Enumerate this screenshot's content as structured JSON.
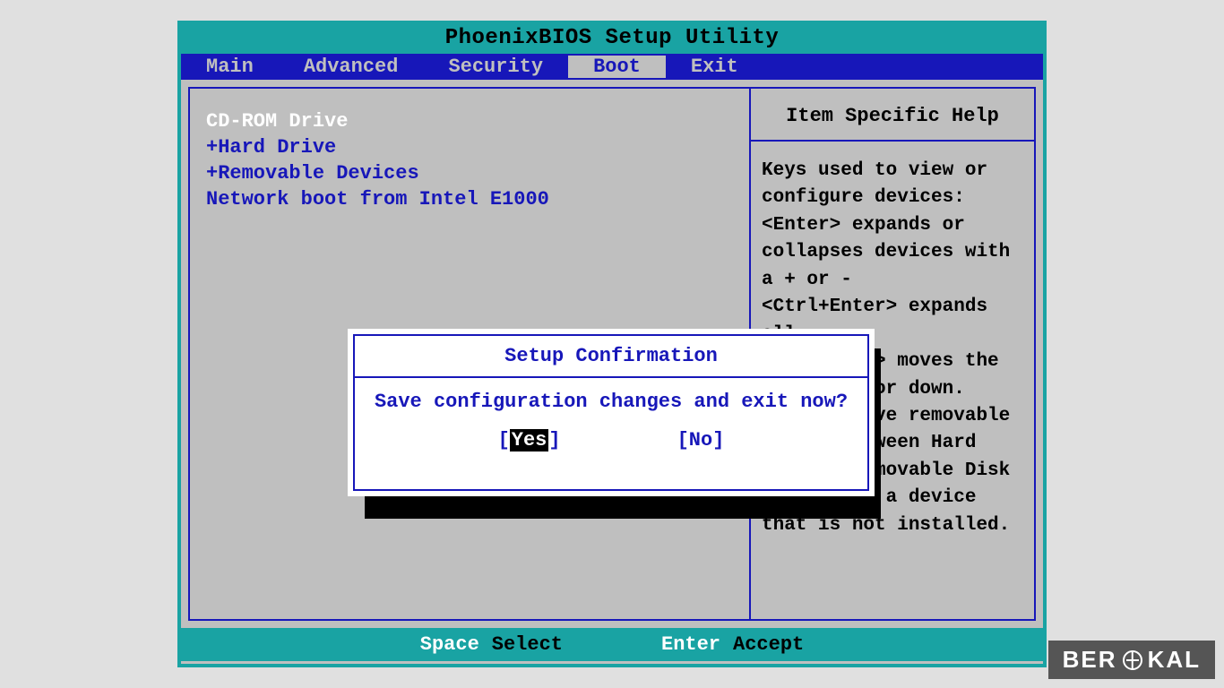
{
  "title": "PhoenixBIOS Setup Utility",
  "menu": {
    "items": [
      "Main",
      "Advanced",
      "Security",
      "Boot",
      "Exit"
    ],
    "active_index": 3
  },
  "boot": {
    "items": [
      {
        "prefix": " ",
        "label": "CD-ROM Drive",
        "selected": true
      },
      {
        "prefix": "+",
        "label": "Hard Drive",
        "selected": false
      },
      {
        "prefix": "+",
        "label": "Removable Devices",
        "selected": false
      },
      {
        "prefix": " ",
        "label": "Network boot from Intel E1000",
        "selected": false
      }
    ]
  },
  "help": {
    "title": "Item Specific Help",
    "body": "Keys used to view or configure devices:\n<Enter> expands or collapses devices with a + or -\n<Ctrl+Enter> expands all\n<+> and <-> moves the device up or down.\n<n> May move removable device between Hard Disk or Removable Disk\n<d> Remove a device that is not installed."
  },
  "footer": {
    "key1": "Space",
    "label1": "Select",
    "key2": "Enter",
    "label2": "Accept"
  },
  "dialog": {
    "title": "Setup Confirmation",
    "message": "Save configuration changes and exit now?",
    "yes": "Yes",
    "no": "No",
    "selected": "yes"
  },
  "watermark": {
    "pre": "BER",
    "post": "KAL"
  }
}
